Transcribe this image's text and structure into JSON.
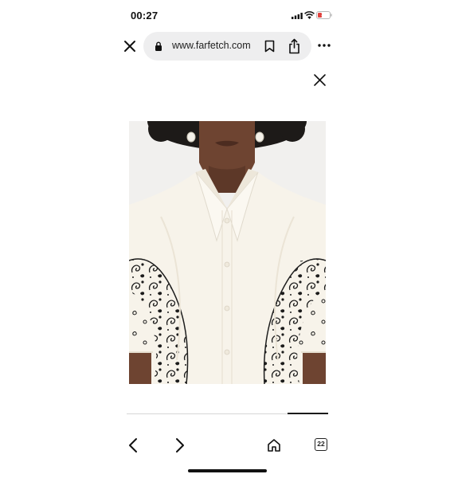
{
  "status_bar": {
    "time": "00:27",
    "battery_level": "18",
    "icons": [
      "signal-icon",
      "wifi-icon",
      "battery-icon"
    ]
  },
  "browser": {
    "url": "www.farfetch.com",
    "icons": [
      "close-icon",
      "lock-icon",
      "bookmark-icon",
      "share-icon",
      "more-icon"
    ]
  },
  "gallery": {
    "close_icon": "close-icon",
    "image_description_visible": false,
    "progress": 0.2
  },
  "toolbar": {
    "tab_count": "22",
    "icons": [
      "back-icon",
      "forward-icon",
      "home-icon",
      "tabs-icon"
    ]
  },
  "colors": {
    "accent": "#e0433f",
    "text": "#111111",
    "url_bar_bg": "#eeeeef",
    "shirt": "#f7f3ea",
    "print": "#1c1c1c"
  }
}
